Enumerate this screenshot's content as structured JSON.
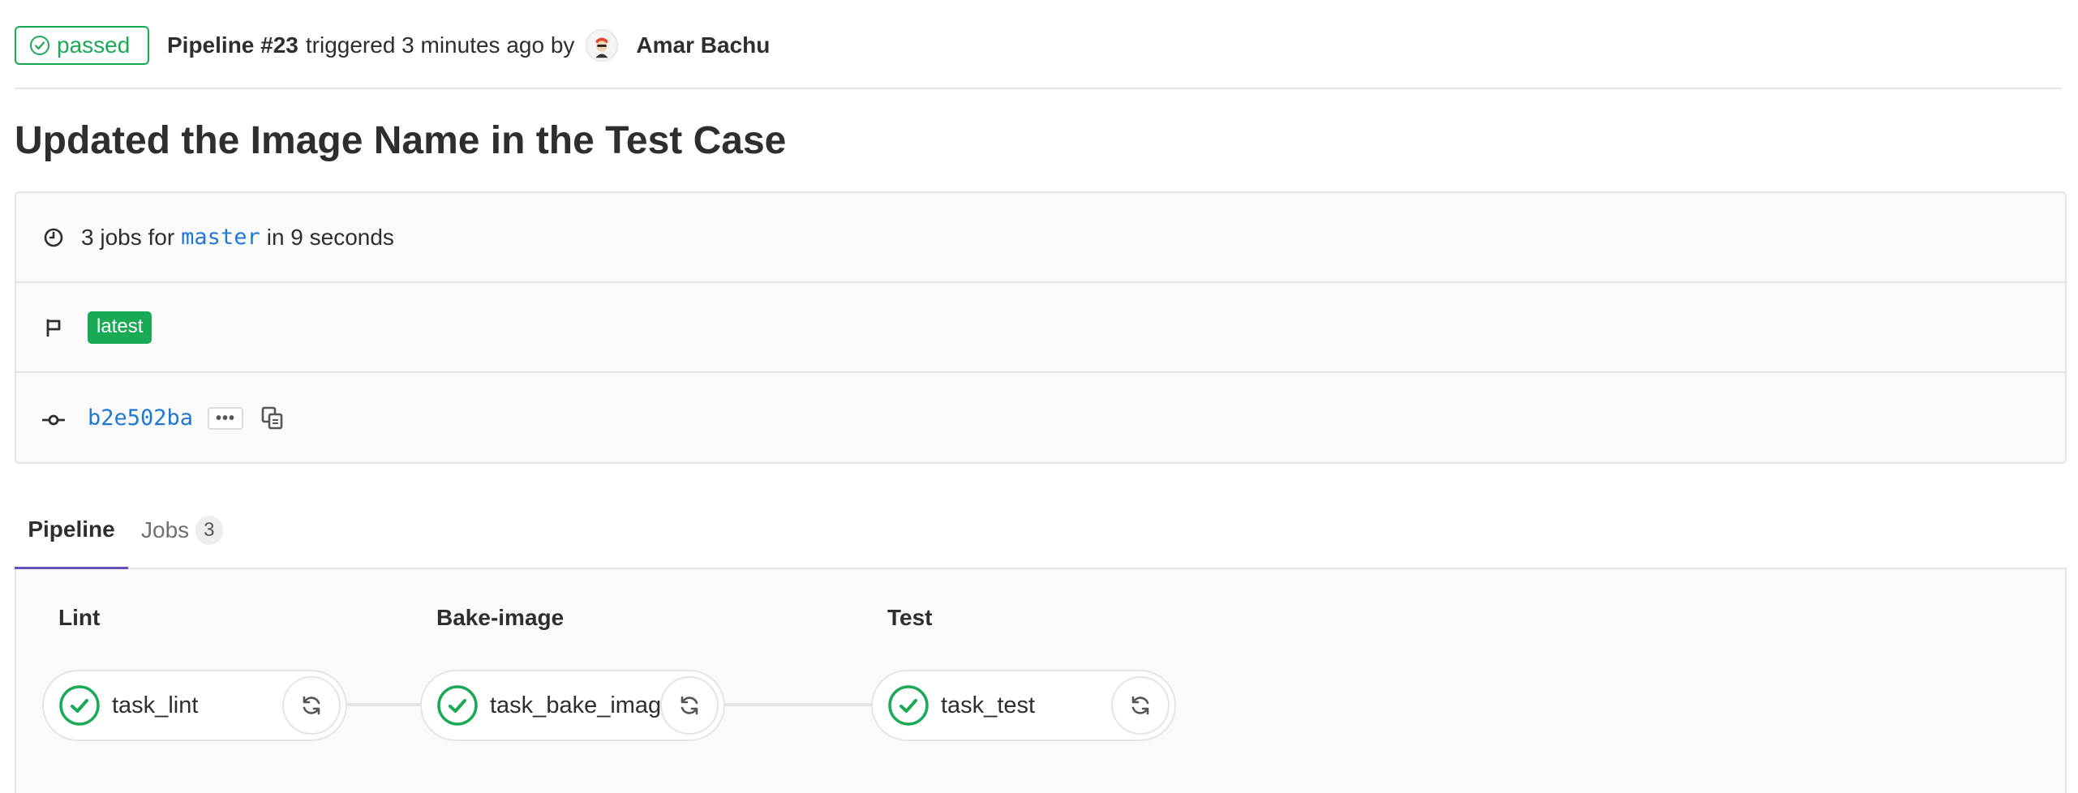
{
  "header": {
    "status_label": "passed",
    "pipeline_id": "Pipeline #23",
    "triggered_text": "triggered 3 minutes ago by",
    "author": "Amar Bachu"
  },
  "title": "Updated the Image Name in the Test Case",
  "info": {
    "jobs_prefix": "3 jobs for",
    "branch": "master",
    "duration_text": "in 9 seconds",
    "tag": "latest",
    "commit_sha": "b2e502ba",
    "ellipsis_label": "•••"
  },
  "tabs": [
    {
      "label": "Pipeline"
    },
    {
      "label": "Jobs",
      "count": "3"
    }
  ],
  "stages": [
    {
      "name": "Lint",
      "job": "task_lint",
      "status": "success"
    },
    {
      "name": "Bake-image",
      "job": "task_bake_image",
      "status": "success"
    },
    {
      "name": "Test",
      "job": "task_test",
      "status": "success"
    }
  ],
  "colors": {
    "success": "#1aaa55",
    "link": "#1f78d1",
    "active_tab": "#6b4fbb"
  },
  "icons": {
    "status": "check-circle-icon",
    "clock": "clock-icon",
    "tag": "flag-icon",
    "commit": "commit-icon",
    "copy": "copy-icon",
    "retry": "retry-icon"
  }
}
